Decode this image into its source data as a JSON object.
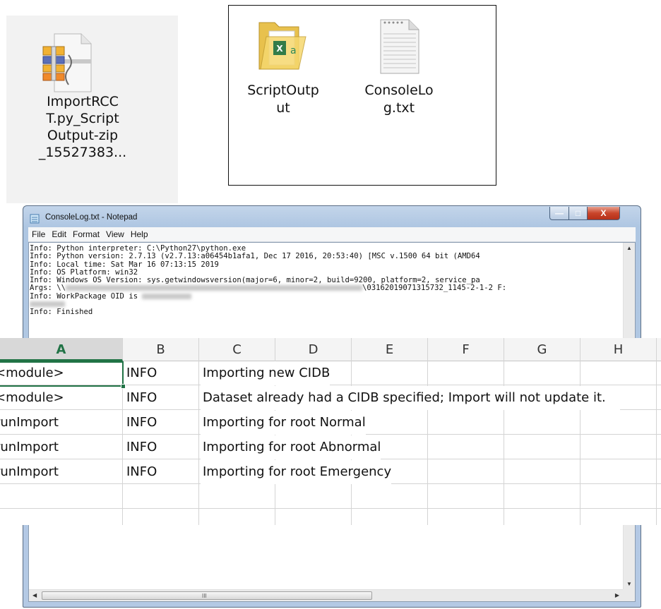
{
  "zip_file": {
    "label": "ImportRCC\nT.py_Script\nOutput-zip\n_15527383..."
  },
  "folder": {
    "items": [
      {
        "label": "ScriptOutp\nut",
        "icon": "excel-folder-icon"
      },
      {
        "label": "ConsoleLo\ng.txt",
        "icon": "text-file-icon"
      }
    ]
  },
  "notepad": {
    "title": "ConsoleLog.txt - Notepad",
    "menu": [
      "File",
      "Edit",
      "Format",
      "View",
      "Help"
    ],
    "log_lines": [
      "Info: Python interpreter: C:\\Python27\\python.exe",
      "Info: Python version: 2.7.13 (v2.7.13:a06454b1afa1, Dec 17 2016, 20:53:40) [MSC v.1500 64 bit (AMD64",
      "Info: Local time: Sat Mar 16 07:13:15 2019",
      "Info: OS Platform: win32",
      "Info: Windows OS Version: sys.getwindowsversion(major=6, minor=2, build=9200, platform=2, service_pa",
      "Args: \\\\",
      "Info: WorkPackage OID is ",
      "",
      "Info: Finished"
    ],
    "args_suffix": "\\03162019071315732_1145-2-1-2 F:",
    "scrollbar_grip": "III",
    "window_buttons": {
      "minimize": "—",
      "maximize": "□",
      "close": "X"
    }
  },
  "spreadsheet": {
    "columns": [
      "A",
      "B",
      "C",
      "D",
      "E",
      "F",
      "G",
      "H"
    ],
    "selected_column": "A",
    "rows": [
      {
        "a": "<module>",
        "b": "INFO",
        "c": "Importing new CIDB"
      },
      {
        "a": "<module>",
        "b": "INFO",
        "c": "Dataset already had a CIDB specified; Import will not update it."
      },
      {
        "a": "runImport",
        "b": "INFO",
        "c": "Importing for root Normal"
      },
      {
        "a": "runImport",
        "b": "INFO",
        "c": "Importing for root Abnormal"
      },
      {
        "a": "runImport",
        "b": "INFO",
        "c": "Importing for root Emergency"
      },
      {
        "a": "",
        "b": "",
        "c": ""
      },
      {
        "a": "",
        "b": "",
        "c": ""
      }
    ],
    "accent_color": "#217346"
  }
}
